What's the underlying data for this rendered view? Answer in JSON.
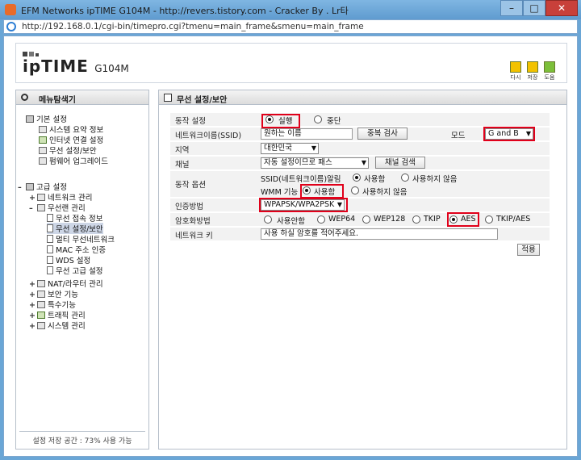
{
  "window": {
    "title": "EFM Networks ipTIME G104M - http://revers.tistory.com - Cracker By . Lr타",
    "url": "http://192.168.0.1/cgi-bin/timepro.cgi?tmenu=main_frame&smenu=main_frame",
    "icons": {
      "app": "app-icon",
      "ie": "ie-icon"
    }
  },
  "header": {
    "logo_main": "ipTIME",
    "logo_model": "G104M",
    "icons": [
      {
        "label": "다시",
        "icon": "refresh-icon",
        "color": "#f2c200"
      },
      {
        "label": "저장",
        "icon": "save-icon",
        "color": "#f2c200"
      },
      {
        "label": "도움",
        "icon": "help-icon",
        "color": "#7cbf3a"
      }
    ]
  },
  "sidebar": {
    "title": "메뉴탐색기",
    "basic": {
      "label": "기본 설정",
      "items": [
        "시스템 요약 정보",
        "인터넷 연결 설정",
        "무선 설정/보안",
        "펌웨어 업그레이드"
      ]
    },
    "advanced": {
      "label": "고급 설정",
      "network": "네트워크 관리",
      "wireless": "무선랜 관리",
      "wireless_items": [
        "무선 접속 정보",
        "무선 설정/보안",
        "멀티 무선네트워크",
        "MAC 주소 인증",
        "WDS 설정",
        "무선 고급 설정"
      ],
      "others": [
        "NAT/라우터 관리",
        "보안 기능",
        "특수기능",
        "트래픽 관리",
        "시스템 관리"
      ]
    },
    "footer": "설정 저장 공간 : 73% 사용 가능"
  },
  "panel": {
    "title": "무선 설정/보안",
    "operation": {
      "label": "동작 설정",
      "on": "실행",
      "off": "중단"
    },
    "ssid": {
      "label": "네트워크이름(SSID)",
      "value": "원하는 이름",
      "search": "중복 검사"
    },
    "mode": {
      "label": "모드",
      "value": "G and B"
    },
    "region": {
      "label": "지역",
      "value": "대한민국"
    },
    "channel": {
      "label": "채널",
      "value": "자동 설정이므로 패스",
      "search": "채널 검색"
    },
    "options": {
      "label": "동작 옵션",
      "ssid_broadcast": "SSID(네트워크이름)알림",
      "wmm": "WMM 기능",
      "use": "사용함",
      "nouse": "사용하지 않음"
    },
    "auth": {
      "label": "인증방법",
      "value": "WPAPSK/WPA2PSK"
    },
    "encryption": {
      "label": "암호화방법",
      "options": [
        "사용안함",
        "WEP64",
        "WEP128",
        "TKIP",
        "AES",
        "TKIP/AES"
      ]
    },
    "key": {
      "label": "네트워크 키",
      "value": "사용 하실 암호를 적어주세요."
    },
    "apply": "적용"
  },
  "colors": {
    "highlight": "#e0001a",
    "titlebar": "#6aa6d6"
  }
}
